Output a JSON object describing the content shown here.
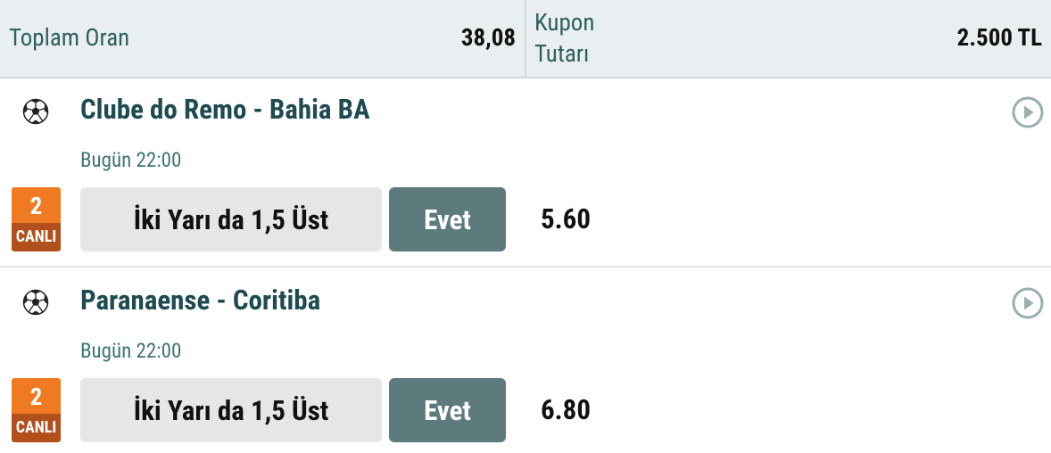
{
  "header": {
    "total_odds_label": "Toplam Oran",
    "total_odds_value": "38,08",
    "coupon_amount_label": "Kupon Tutarı",
    "coupon_amount_value": "2.500 TL"
  },
  "bets": [
    {
      "sport_icon": "soccer-ball-icon",
      "match": "Clube do Remo - Bahia BA",
      "time": "Bugün 22:00",
      "live_number": "2",
      "live_label": "CANLI",
      "market": "İki Yarı da 1,5 Üst",
      "pick": "Evet",
      "odd": "5.60",
      "detail_icon": "play-circle-icon"
    },
    {
      "sport_icon": "soccer-ball-icon",
      "match": "Paranaense - Coritiba",
      "time": "Bugün 22:00",
      "live_number": "2",
      "live_label": "CANLI",
      "market": "İki Yarı da 1,5 Üst",
      "pick": "Evet",
      "odd": "6.80",
      "detail_icon": "play-circle-icon"
    }
  ],
  "colors": {
    "header_bg": "#e9eef0",
    "title_text": "#1e4a50",
    "time_text": "#3f7474",
    "live_orange": "#f07a22",
    "live_dark": "#b2501c",
    "pick_button": "#5d7a7d",
    "market_bg": "#e6e6e6"
  }
}
